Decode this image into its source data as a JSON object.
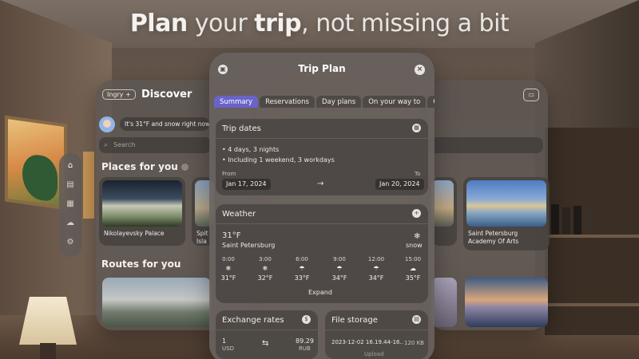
{
  "headline": {
    "strong1": "Plan",
    "light1": " your ",
    "strong2": "trip",
    "light2": ", not missing a bit"
  },
  "discover": {
    "tag": "Ingry +",
    "title": "Discover",
    "bubble": "It's 31°F and snow right now",
    "search_placeholder": "Search",
    "places_title": "Places for you",
    "routes_title": "Routes for you",
    "places": [
      {
        "label": "Nikolayevsky Palace"
      },
      {
        "label": "Spit\nIsla"
      }
    ]
  },
  "right_panel": {
    "places": [
      {
        "label": "Saint Petersburg\nAcademy Of Arts"
      }
    ]
  },
  "trip": {
    "title": "Trip Plan",
    "tabs": [
      "Summary",
      "Reservations",
      "Day plans",
      "On your way to",
      "C"
    ],
    "active_tab": "Summary",
    "dates": {
      "header": "Trip dates",
      "line1": "• 4 days, 3 nights",
      "line2": "• Including 1 weekend, 3 workdays",
      "from_label": "From",
      "to_label": "To",
      "from": "Jan 17, 2024",
      "to": "Jan 20, 2024",
      "arrow": "→"
    },
    "weather": {
      "header": "Weather",
      "temp": "31°F",
      "city": "Saint Petersburg",
      "condition": "snow",
      "hours": [
        {
          "t": "0:00",
          "v": "31°F",
          "icon": "snow-icon"
        },
        {
          "t": "3:00",
          "v": "32°F",
          "icon": "snow-icon"
        },
        {
          "t": "6:00",
          "v": "33°F",
          "icon": "rain-icon"
        },
        {
          "t": "9:00",
          "v": "34°F",
          "icon": "rain-icon"
        },
        {
          "t": "12:00",
          "v": "34°F",
          "icon": "rain-icon"
        },
        {
          "t": "15:00",
          "v": "35°F",
          "icon": "cloud-icon"
        }
      ],
      "expand": "Expand"
    },
    "exchange": {
      "header": "Exchange rates",
      "from_amount": "1",
      "from_currency": "USD",
      "to_amount": "89.29",
      "to_currency": "RUB"
    },
    "storage": {
      "header": "File storage",
      "file": "2023-12-02 16.19.44-16...",
      "size": "120 KB",
      "upload": "Upload"
    }
  }
}
